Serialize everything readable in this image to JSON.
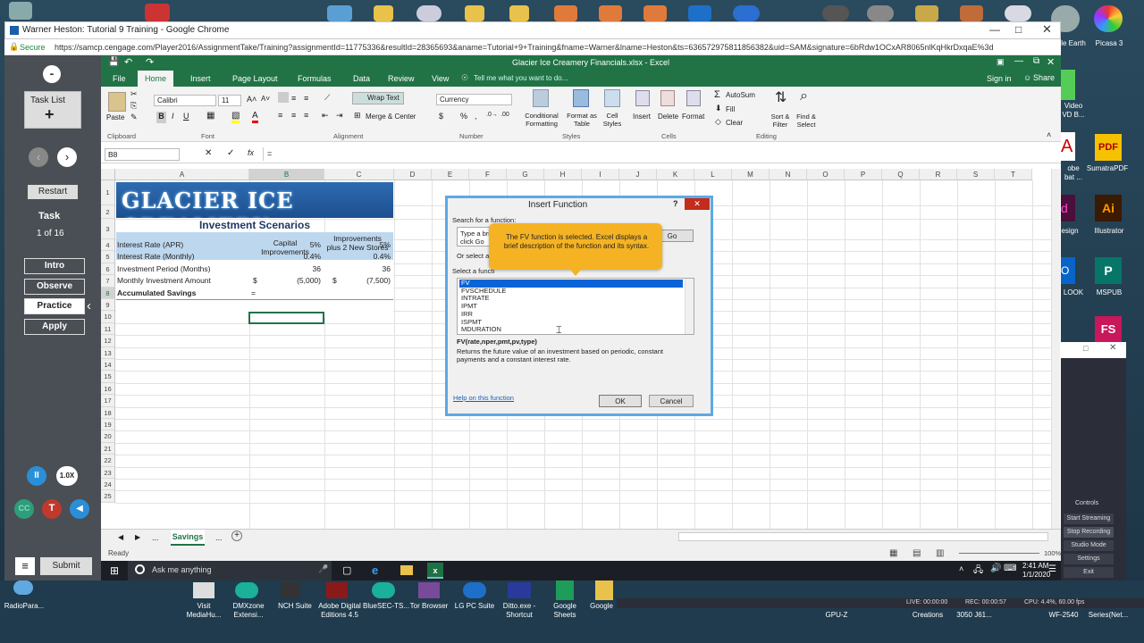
{
  "browser": {
    "tab_title": "Warner Heston: Tutorial 9 Training - Google Chrome",
    "secure_label": "Secure",
    "url": "https://samcp.cengage.com/Player2016/AssignmentTake/Training?assignmentId=11775336&resultId=28365693&aname=Tutorial+9+Training&fname=Warner&lname=Heston&ts=636572975811856382&uid=SAM&signature=6bRdw1OCxAR8065nlKqHkrDxqaE%3d"
  },
  "player": {
    "task_list": "Task List",
    "restart": "Restart",
    "task_label": "Task",
    "task_counter": "1 of 16",
    "modes": [
      "Intro",
      "Observe",
      "Practice",
      "Apply"
    ],
    "speed": "1.0X",
    "cc": "CC",
    "t": "T",
    "submit": "Submit"
  },
  "excel": {
    "title": "Glacier Ice Creamery Financials.xlsx - Excel",
    "signin": "Sign in",
    "share": "Share",
    "tabs": [
      "File",
      "Home",
      "Insert",
      "Page Layout",
      "Formulas",
      "Data",
      "Review",
      "View"
    ],
    "tell_me": "Tell me what you want to do...",
    "font_name": "Calibri",
    "font_size": "11",
    "wrap_text": "Wrap Text",
    "merge_center": "Merge & Center",
    "number_format": "Currency",
    "cond_format": "Conditional Formatting",
    "format_table": "Format as Table",
    "cell_styles": "Cell Styles",
    "insert": "Insert",
    "delete": "Delete",
    "format": "Format",
    "autosum": "AutoSum",
    "fill": "Fill",
    "clear": "Clear",
    "sort_filter": "Sort & Filter",
    "find_select": "Find & Select",
    "paste": "Paste",
    "groups": [
      "Clipboard",
      "Font",
      "Alignment",
      "Number",
      "Styles",
      "Cells",
      "Editing"
    ],
    "name_box": "B8",
    "formula": "=",
    "fx": "fx",
    "col_headers": [
      "A",
      "B",
      "C",
      "D",
      "E",
      "F",
      "G",
      "H",
      "I",
      "J",
      "K",
      "L",
      "M",
      "N",
      "O",
      "P",
      "Q",
      "R",
      "S",
      "T"
    ],
    "row_headers": [
      "1",
      "2",
      "3",
      "4",
      "5",
      "6",
      "7",
      "8",
      "9",
      "10",
      "11",
      "12",
      "13",
      "14",
      "15",
      "16",
      "17",
      "18",
      "19",
      "20",
      "21",
      "22",
      "23",
      "24",
      "25"
    ],
    "sheet": {
      "banner": "GLACIER ICE CREAMERY",
      "subtitle": "Investment Scenarios",
      "col_b_header": "Capital Improvements",
      "col_c_header": "Improvements plus 2 New Stores",
      "rows": [
        {
          "label": "Interest Rate (APR)",
          "b": "5%",
          "c": "5%"
        },
        {
          "label": "Interest Rate (Monthly)",
          "b": "0.4%",
          "c": "0.4%"
        },
        {
          "label": "Investment Period (Months)",
          "b": "36",
          "c": "36"
        },
        {
          "label": "Monthly Investment Amount",
          "b_sym": "$",
          "b": "(5,000)",
          "c_sym": "$",
          "c": "(7,500)"
        },
        {
          "label": "Accumulated Savings",
          "b": "=",
          "c": ""
        }
      ]
    },
    "sheet_tab": "Savings",
    "ellipsis": "...",
    "status": "Ready",
    "zoom": "100%"
  },
  "dialog": {
    "title": "Insert Function",
    "search_label": "Search for a function:",
    "search_value": "Type a bri",
    "search_value2": "click Go",
    "go": "Go",
    "or_select": "Or select a",
    "select_label": "Select a functi",
    "functions": [
      "FV",
      "FVSCHEDULE",
      "INTRATE",
      "IPMT",
      "IRR",
      "ISPMT",
      "MDURATION"
    ],
    "syntax": "FV(rate,nper,pmt,pv,type)",
    "description": "Returns the future value of an investment based on periodic, constant payments and a constant interest rate.",
    "help": "Help on this function",
    "ok": "OK",
    "cancel": "Cancel",
    "help_q": "?",
    "tooltip": "The FV function is selected. Excel displays a brief description of the function and its syntax."
  },
  "taskbar": {
    "search": "Ask me anything",
    "time": "2:41 AM",
    "date": "1/1/2020"
  },
  "desktop_right": [
    {
      "label": "le Earth"
    },
    {
      "label": "Picasa 3"
    },
    {
      "label": "Video\nVD B..."
    },
    {
      "label": "obe\nbat ..."
    },
    {
      "label": "SumatraPDF"
    },
    {
      "label": "esign"
    },
    {
      "label": "Illustrator"
    },
    {
      "label": "LOOK"
    },
    {
      "label": "MSPUB"
    }
  ],
  "obs": {
    "controls": "Controls",
    "buttons": [
      "Start Streaming",
      "Stop Recording",
      "Studio Mode",
      "Settings",
      "Exit"
    ]
  },
  "bottom_icons": [
    {
      "label": "RadioPara..."
    },
    {
      "label": "Visit\nMediaHu..."
    },
    {
      "label": "DMXzone\nExtensi..."
    },
    {
      "label": "NCH Suite"
    },
    {
      "label": "Adobe Digital\nEditions 4.5"
    },
    {
      "label": "BlueSEC-TS..."
    },
    {
      "label": "Tor Browser"
    },
    {
      "label": "LG PC Suite"
    },
    {
      "label": "Ditto.exe -\nShortcut"
    },
    {
      "label": "Google\nSheets"
    },
    {
      "label": "Google"
    },
    {
      "label": "GPU-Z"
    },
    {
      "label": "Creations"
    },
    {
      "label": "3050 J61..."
    },
    {
      "label": "WF-2540"
    },
    {
      "label": "Series(Net..."
    }
  ],
  "obs_status": {
    "live": "LIVE: 00:00:00",
    "rec": "REC: 00:00:57",
    "cpu": "CPU: 4.4%, 60.00 fps"
  }
}
